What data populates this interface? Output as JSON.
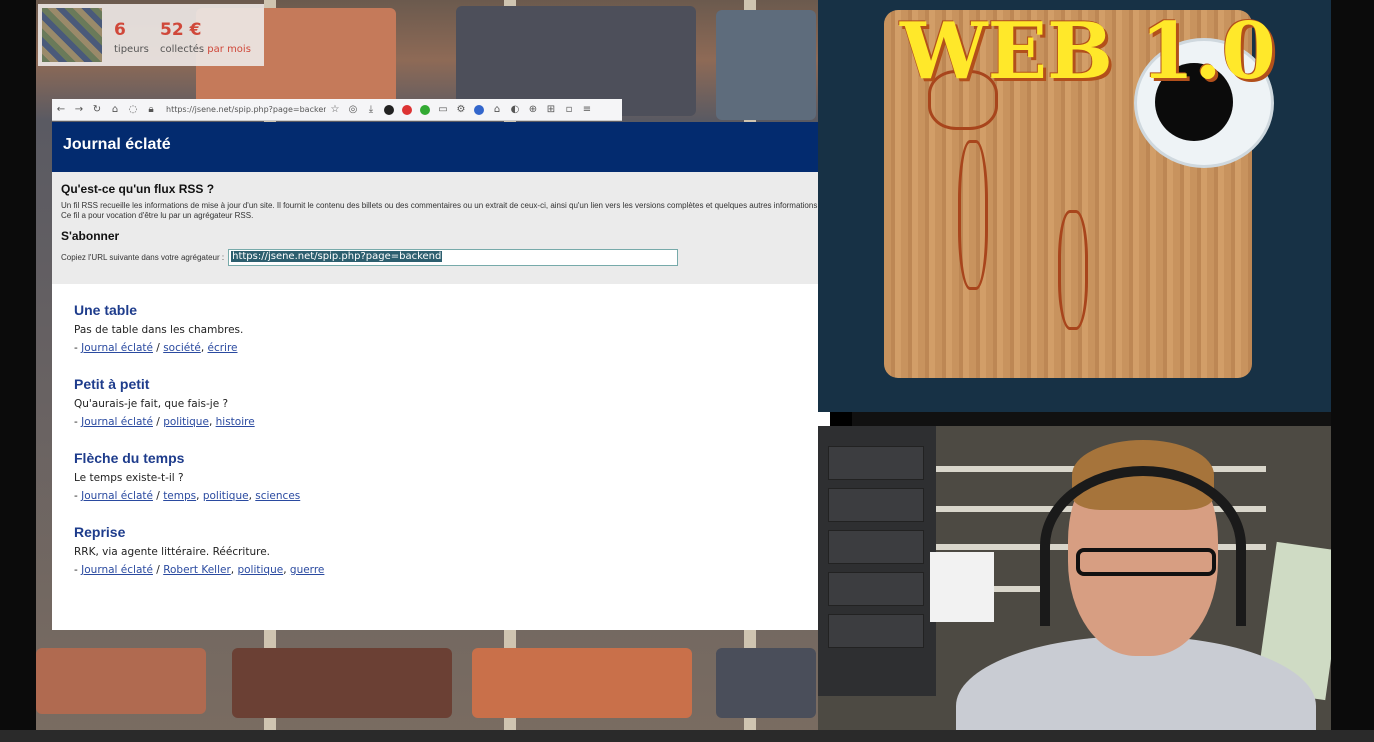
{
  "donation": {
    "tippers_count": "6",
    "tippers_label": "tipeurs",
    "amount": "52 €",
    "collected_label": "collectés",
    "per_month_label": "par mois"
  },
  "overlay_title": "WEB 1.0",
  "browser": {
    "url": "https://jsene.net/spip.php?page=backend"
  },
  "page": {
    "site_title": "Journal éclaté",
    "rss": {
      "heading": "Qu'est-ce qu'un flux RSS ?",
      "description": "Un fil RSS recueille les informations de mise à jour d'un site. Il fournit le contenu des billets ou des commentaires ou un extrait de ceux-ci, ainsi qu'un lien vers les versions complètes et quelques autres informations. Ce fil a pour vocation d'être lu par un agrégateur RSS.",
      "subscribe_heading": "S'abonner",
      "subscribe_label": "Copiez l'URL suivante dans votre agrégateur :",
      "feed_url": "https://jsene.net/spip.php?page=backend"
    },
    "articles": [
      {
        "title": "Une table",
        "description": "Pas de table dans les chambres.",
        "section": "Journal éclaté",
        "tags": [
          "société",
          "écrire"
        ]
      },
      {
        "title": "Petit à petit",
        "description": "Qu'aurais-je fait, que fais-je ?",
        "section": "Journal éclaté",
        "tags": [
          "politique",
          "histoire"
        ]
      },
      {
        "title": "Flèche du temps",
        "description": "Le temps existe-t-il ?",
        "section": "Journal éclaté",
        "tags": [
          "temps",
          "politique",
          "sciences"
        ]
      },
      {
        "title": "Reprise",
        "description": "RRK, via agente littéraire. Réécriture.",
        "section": "Journal éclaté",
        "tags": [
          "Robert Keller",
          "politique",
          "guerre"
        ]
      }
    ]
  },
  "colors": {
    "header_bg": "#032b6f",
    "article_title": "#1e3c8c",
    "link": "#2a4aa0",
    "overlay_title": "#ffe82a",
    "donation_accent": "#d0483a"
  }
}
